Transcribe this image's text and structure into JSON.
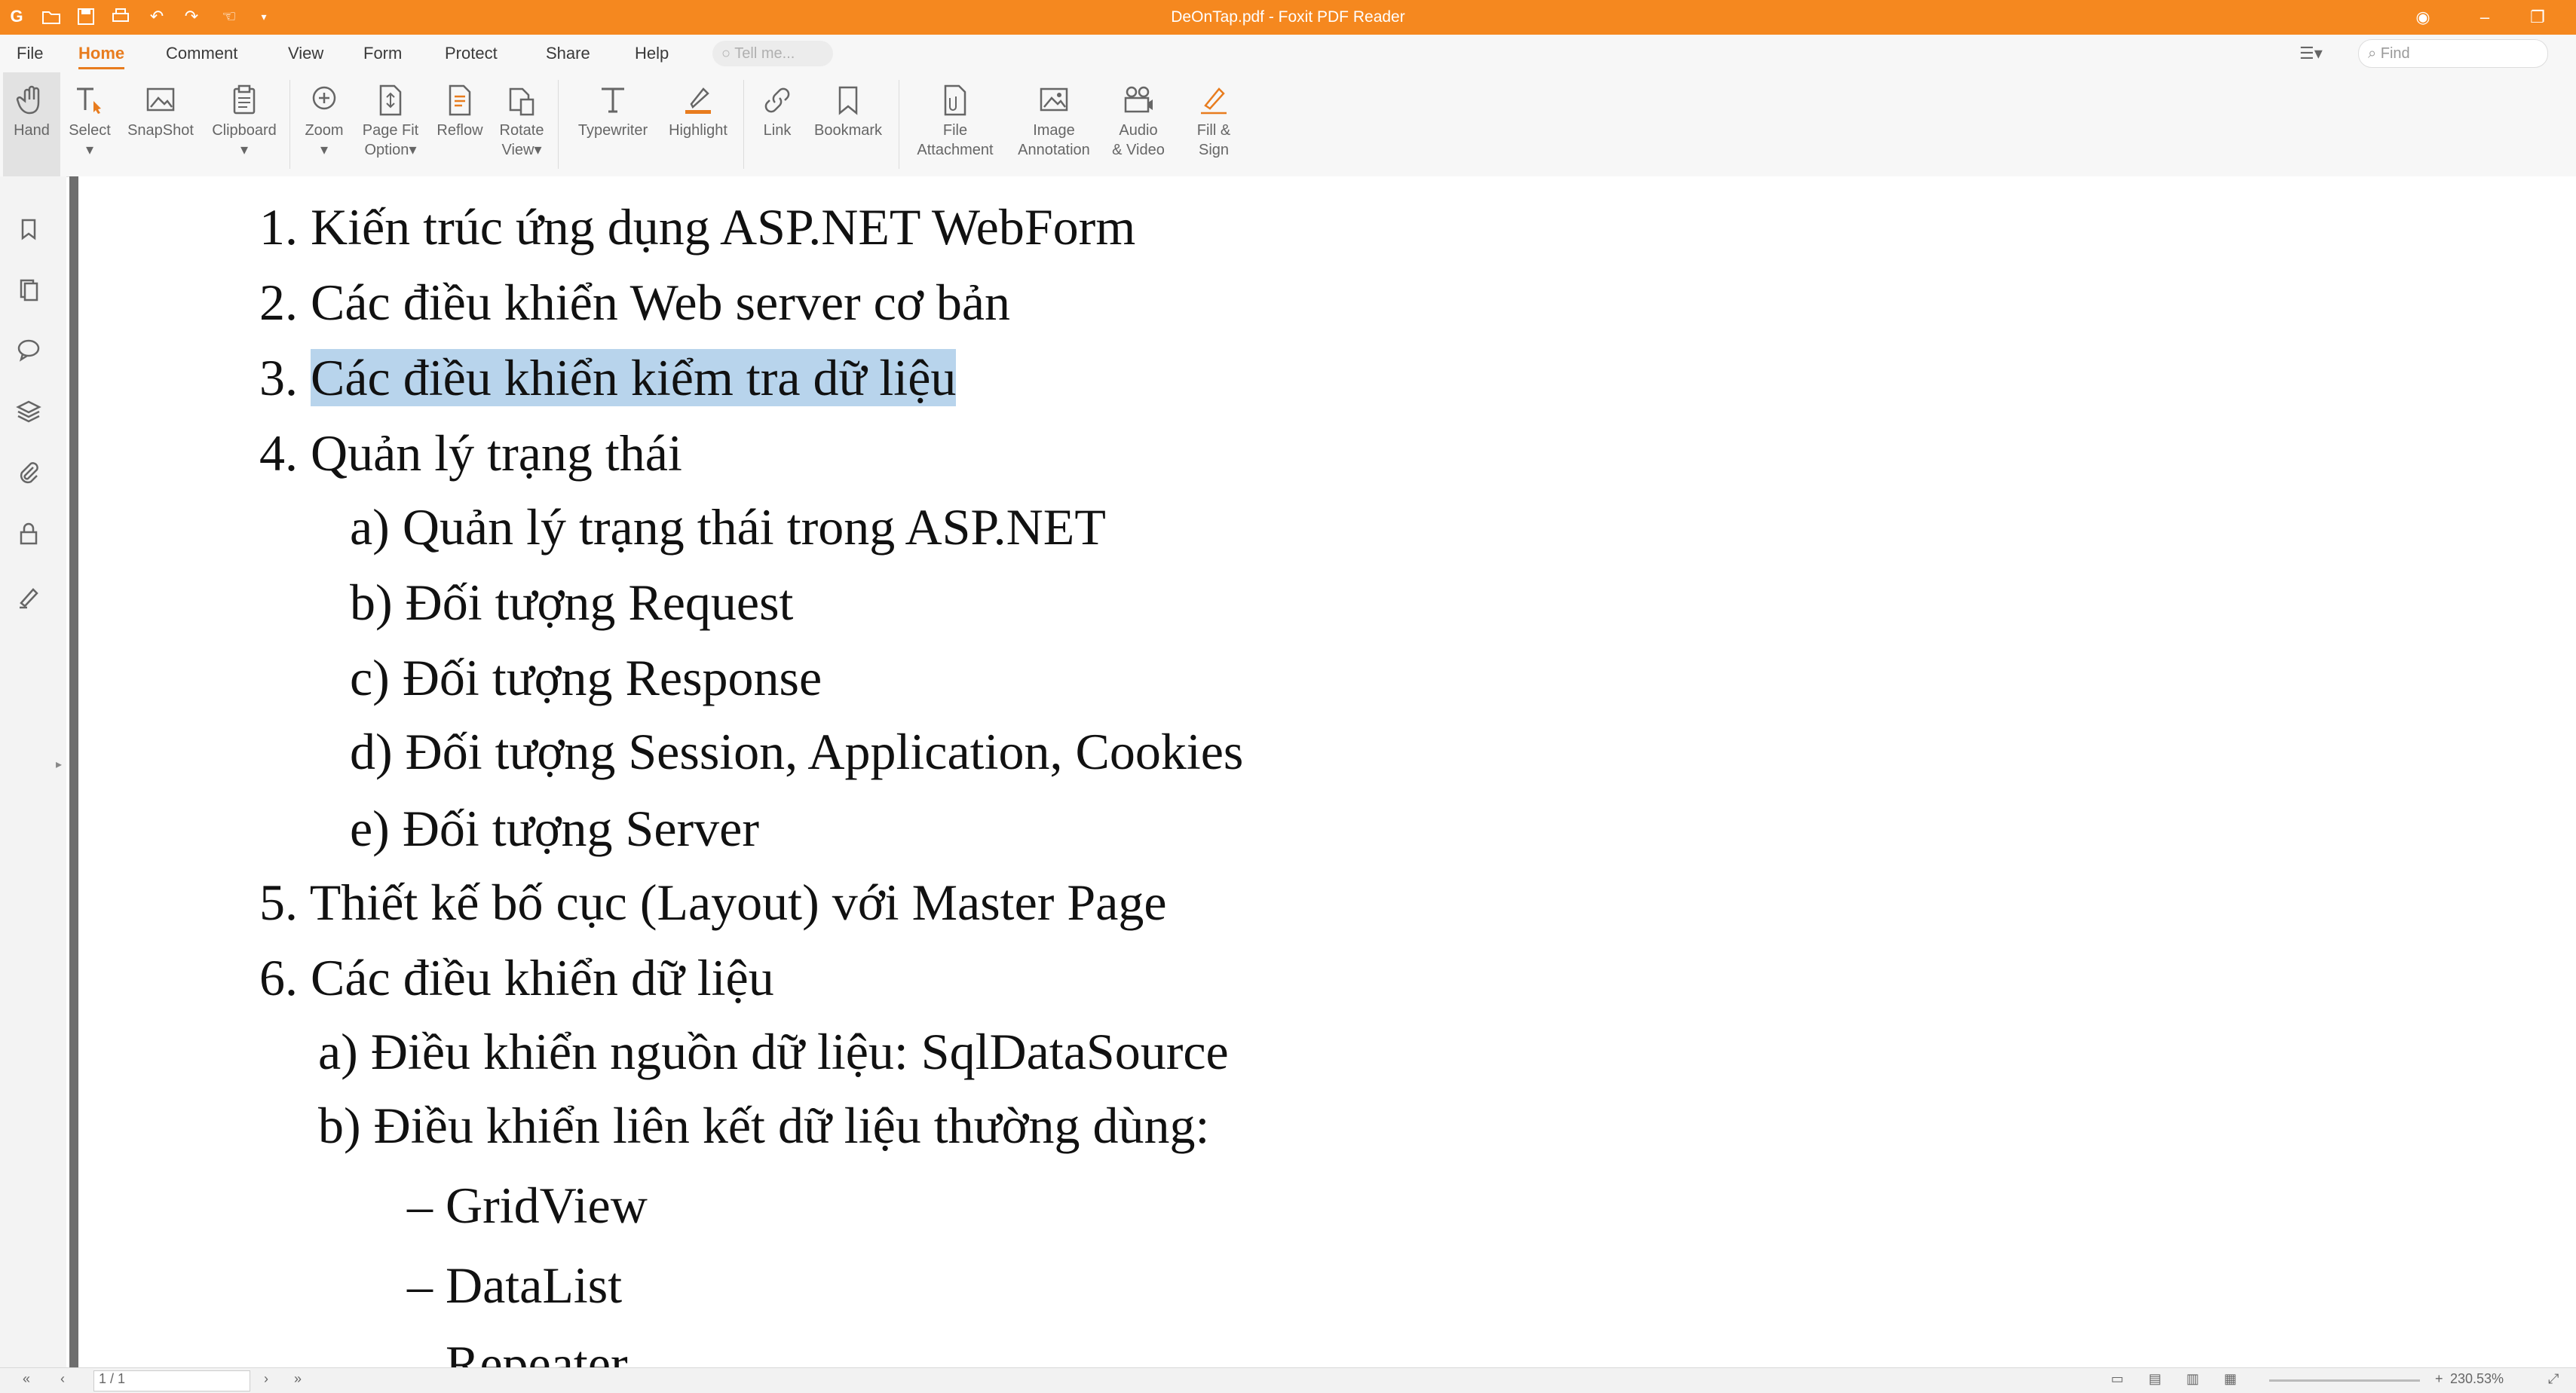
{
  "titlebar": {
    "title": "DeOnTap.pdf - Foxit PDF Reader"
  },
  "menu": {
    "items": [
      "File",
      "Home",
      "Comment",
      "View",
      "Form",
      "Protect",
      "Share",
      "Help"
    ],
    "tell_me_placeholder": "Tell me...",
    "find_placeholder": "Find"
  },
  "ribbon": {
    "hand": "Hand",
    "select": "Select",
    "snapshot": "SnapShot",
    "clipboard": "Clipboard",
    "zoom": "Zoom",
    "page_fit_1": "Page Fit",
    "page_fit_2": "Option",
    "reflow": "Reflow",
    "rotate_1": "Rotate",
    "rotate_2": "View",
    "typewriter": "Typewriter",
    "highlight": "Highlight",
    "link": "Link",
    "bookmark": "Bookmark",
    "file_att_1": "File",
    "file_att_2": "Attachment",
    "image_ann_1": "Image",
    "image_ann_2": "Annotation",
    "audio_1": "Audio",
    "audio_2": "& Video",
    "fill_1": "Fill &",
    "fill_2": "Sign"
  },
  "document": {
    "lines": [
      "1. Kiến trúc ứng dụng ASP.NET WebForm",
      "2. Các điều khiển Web server cơ bản",
      "3. ",
      "Các điều khiển kiểm tra dữ liệu",
      "4. Quản lý trạng thái",
      "a) Quản lý trạng thái trong ASP.NET",
      "b) Đối tượng Request",
      "c) Đối tượng Response",
      "d) Đối tượng Session, Application, Cookies",
      "e) Đối tượng Server",
      "5. Thiết kế bố cục (Layout) với Master Page",
      "6. Các điều khiển dữ liệu",
      "a) Điều khiển nguồn dữ liệu: SqlDataSource",
      "b) Điều khiển liên kết dữ liệu thường dùng:",
      "– GridView",
      "– DataList",
      "– Repeater"
    ]
  },
  "status": {
    "page": "1 / 1",
    "zoom": "230.53%"
  },
  "colors": {
    "accent": "#f5881f",
    "highlight": "#b8d4ec"
  }
}
